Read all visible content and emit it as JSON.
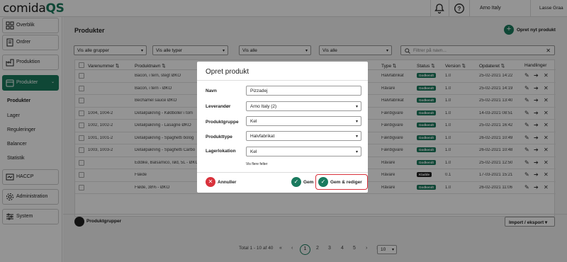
{
  "app": {
    "logo_main": "comida",
    "logo_accent": "QS"
  },
  "topbar": {
    "company": "Arno Italy",
    "user": "Lasse Graa",
    "bell_icon": "bell-icon",
    "help_icon": "help-icon"
  },
  "sidebar": {
    "items": [
      {
        "label": "Overblik",
        "icon": "dashboard-icon"
      },
      {
        "label": "Ordrer",
        "icon": "orders-icon"
      },
      {
        "label": "Produktion",
        "icon": "production-icon"
      },
      {
        "label": "Produkter",
        "icon": "products-icon"
      },
      {
        "label": "HACCP",
        "icon": "haccp-icon"
      },
      {
        "label": "Administration",
        "icon": "gear-icon"
      },
      {
        "label": "System",
        "icon": "system-icon"
      }
    ],
    "subitems": [
      "Produkter",
      "Lager",
      "Reguleringer",
      "Balancer",
      "Statistik"
    ]
  },
  "page": {
    "title": "Produkter",
    "new_button": "Opret nyt produkt",
    "filters": [
      "Vis alle grupper",
      "Vis alle typer",
      "Vis alle",
      "Vis alle"
    ],
    "search_placeholder": "Filtrer på navn...",
    "columns": [
      "Varenummer",
      "Produktnavn",
      "Type",
      "Status",
      "Version",
      "Opdateret",
      "Handlinger"
    ],
    "rows": [
      {
        "nr": "",
        "name": "Bacon, i tern, stegt ØKO",
        "type": "Halvfabrikat",
        "status": "Godkendt",
        "version": "1.0",
        "updated": "25-02-2021 14:22"
      },
      {
        "nr": "",
        "name": "Bacon, i tern - ØKO",
        "type": "Råvare",
        "status": "Godkendt",
        "version": "1.0",
        "updated": "25-02-2021 14:19"
      },
      {
        "nr": "",
        "name": "Bechamel sauce ØKO",
        "type": "Halvfabrikat",
        "status": "Godkendt",
        "version": "1.0",
        "updated": "25-02-2021 13:40"
      },
      {
        "nr": "1004, 1004-2",
        "name": "Detailpakning - Kødboller i tom",
        "type": "Færdigvare",
        "status": "Godkendt",
        "version": "1.0",
        "updated": "14-03-2021 08:51"
      },
      {
        "nr": "1002, 1002-2",
        "name": "Detailpakning - Lasagne ØKO",
        "type": "Færdigvare",
        "status": "Godkendt",
        "version": "1.0",
        "updated": "25-02-2021 16:42"
      },
      {
        "nr": "1001, 1001-2",
        "name": "Detailpakning - Spaghetti bolog",
        "type": "Færdigvare",
        "status": "Godkendt",
        "version": "1.0",
        "updated": "26-02-2021 10:49"
      },
      {
        "nr": "1003, 1003-2",
        "name": "Detailpakning - Spaghetti Carbo",
        "type": "Færdigvare",
        "status": "Godkendt",
        "version": "1.0",
        "updated": "26-02-2021 10:48"
      },
      {
        "nr": "",
        "name": "Eddike, Balsamico, rød, 5L - ØKO",
        "type": "Råvare",
        "status": "Godkendt",
        "version": "1.0",
        "updated": "25-02-2021 12:50"
      },
      {
        "nr": "",
        "name": "Flæde",
        "type": "Råvare",
        "status": "Kladde",
        "version": "0.1",
        "updated": "17-03-2021 15:21"
      },
      {
        "nr": "",
        "name": "Fløde, 38% - ØKO",
        "type": "Råvare",
        "status": "Godkendt",
        "version": "1.0",
        "updated": "26-02-2021 11:06"
      }
    ],
    "pagination": {
      "total": "Total 1 - 10 af 40",
      "pages": [
        "1",
        "2",
        "3",
        "4",
        "5"
      ],
      "current": "1",
      "per_page": "10"
    },
    "product_groups_button": "Produktgrupper",
    "import_button": "Import / eksport"
  },
  "colors": {
    "brand": "#1a7a5e",
    "danger": "#d9323c",
    "draft": "#222222"
  },
  "modal": {
    "title": "Opret produkt",
    "fields": [
      {
        "label": "Navn",
        "value": "Pizzadej"
      },
      {
        "label": "Leverandør",
        "value": "Arno Italy (2)"
      },
      {
        "label": "Produktgruppe",
        "value": "Kel"
      },
      {
        "label": "Produkttype",
        "value": "Halvfabrikat"
      },
      {
        "label": "Lagerlokation",
        "value": "Kel"
      }
    ],
    "more_link": "Vis flere felter",
    "cancel": "Annuller",
    "save": "Gem",
    "save_edit": "Gem & rediger"
  }
}
